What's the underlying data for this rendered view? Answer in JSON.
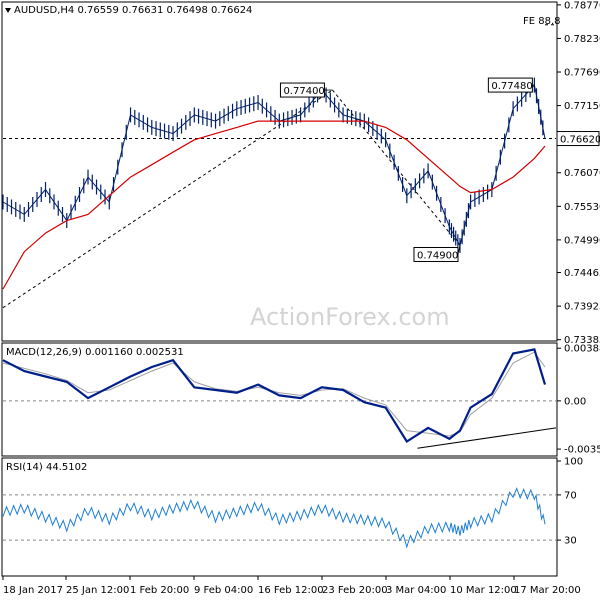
{
  "chart_data": [
    {
      "type": "line",
      "panel": "price",
      "title": "AUDUSD,H4  0.76559 0.76631 0.76498 0.76624",
      "fibo_label": "FE 88.8",
      "watermark": "ActionForex.com",
      "current_price_label": "0.76620",
      "current_price": 0.7662,
      "ylim": [
        0.7338,
        0.788
      ],
      "y_ticks": [
        "0.78770",
        "0.78230",
        "0.77690",
        "0.77150",
        "0.76620",
        "0.76070",
        "0.75530",
        "0.74990",
        "0.74465",
        "0.73925",
        "0.73385"
      ],
      "y_tick_values": [
        0.7877,
        0.7823,
        0.7769,
        0.7715,
        0.7662,
        0.7607,
        0.7553,
        0.7499,
        0.74465,
        0.73925,
        0.73385
      ],
      "x_ticks": [
        "18 Jan 2017",
        "25 Jan 12:00",
        "1 Feb 20:00",
        "9 Feb 04:00",
        "16 Feb 12:00",
        "23 Feb 20:00",
        "3 Mar 04:00",
        "10 Mar 12:00",
        "17 Mar 20:00"
      ],
      "x": [
        0,
        10,
        20,
        30,
        40,
        50,
        60,
        70,
        80,
        90,
        100,
        110,
        120,
        130,
        140,
        150,
        160,
        170,
        180,
        190,
        200,
        210,
        215,
        220,
        230,
        240,
        250,
        255
      ],
      "series": [
        {
          "values": [
            0.756,
            0.754,
            0.758,
            0.753,
            0.76,
            0.756,
            0.77,
            0.768,
            0.767,
            0.77,
            0.769,
            0.771,
            0.772,
            0.769,
            0.77,
            0.774,
            0.77,
            0.769,
            0.766,
            0.757,
            0.761,
            0.752,
            0.749,
            0.756,
            0.758,
            0.771,
            0.7748,
            0.7662
          ]
        },
        {
          "values": [
            0.742,
            0.748,
            0.751,
            0.753,
            0.754,
            0.757,
            0.76,
            0.762,
            0.764,
            0.766,
            0.767,
            0.768,
            0.769,
            0.769,
            0.769,
            0.769,
            0.769,
            0.769,
            0.768,
            0.766,
            0.763,
            0.76,
            0.7585,
            0.7575,
            0.758,
            0.76,
            0.763,
            0.765
          ]
        }
      ],
      "annotations": [
        {
          "label": "0.77400",
          "x": 155,
          "y": 0.774
        },
        {
          "label": "0.77480",
          "x": 250,
          "y": 0.7748
        },
        {
          "label": "0.74900",
          "x": 215,
          "y": 0.749
        }
      ]
    },
    {
      "type": "line",
      "panel": "macd",
      "title": "MACD(12,26,9) 0.001160 0.002531",
      "ylim": [
        -0.004,
        0.0042
      ],
      "y_ticks": [
        "0.003888",
        "0.00",
        "-0.003564"
      ],
      "y_tick_values": [
        0.003888,
        0.0,
        -0.003564
      ],
      "x": [
        0,
        10,
        20,
        30,
        40,
        50,
        60,
        70,
        80,
        90,
        100,
        110,
        120,
        130,
        140,
        150,
        160,
        170,
        180,
        190,
        200,
        210,
        215,
        220,
        230,
        240,
        250,
        255
      ],
      "series": [
        {
          "values": [
            0.003,
            0.0022,
            0.0018,
            0.0014,
            0.0002,
            0.001,
            0.0018,
            0.0025,
            0.003,
            0.001,
            0.0008,
            0.0006,
            0.0012,
            0.0004,
            0.0002,
            0.001,
            0.0008,
            -0.0001,
            -0.0005,
            -0.003,
            -0.002,
            -0.0028,
            -0.0022,
            -0.0005,
            0.0005,
            0.0035,
            0.0038,
            0.0012
          ]
        },
        {
          "values": [
            0.0028,
            0.0024,
            0.002,
            0.0015,
            0.0006,
            0.0008,
            0.0015,
            0.0022,
            0.0028,
            0.0014,
            0.0009,
            0.0007,
            0.001,
            0.0006,
            0.0004,
            0.0008,
            0.0009,
            0.0002,
            -0.0003,
            -0.0022,
            -0.0024,
            -0.0026,
            -0.0023,
            -0.001,
            0.0002,
            0.0028,
            0.0036,
            0.0025
          ]
        }
      ],
      "trendline": [
        [
          195,
          -0.0035
        ],
        [
          278,
          -0.002
        ]
      ]
    },
    {
      "type": "line",
      "panel": "rsi",
      "title": "RSI(14) 44.5102",
      "ylim": [
        0,
        100
      ],
      "y_ticks": [
        "100",
        "70",
        "30"
      ],
      "y_tick_values": [
        100,
        70,
        30
      ],
      "x": [
        0,
        10,
        20,
        30,
        40,
        50,
        60,
        70,
        80,
        90,
        100,
        110,
        120,
        130,
        140,
        150,
        160,
        170,
        180,
        190,
        200,
        210,
        215,
        220,
        230,
        240,
        250,
        255
      ],
      "series": [
        {
          "values": [
            55,
            58,
            50,
            42,
            56,
            48,
            60,
            52,
            58,
            62,
            50,
            55,
            60,
            48,
            52,
            58,
            50,
            48,
            45,
            28,
            40,
            42,
            38,
            45,
            50,
            72,
            70,
            44
          ]
        }
      ]
    }
  ]
}
